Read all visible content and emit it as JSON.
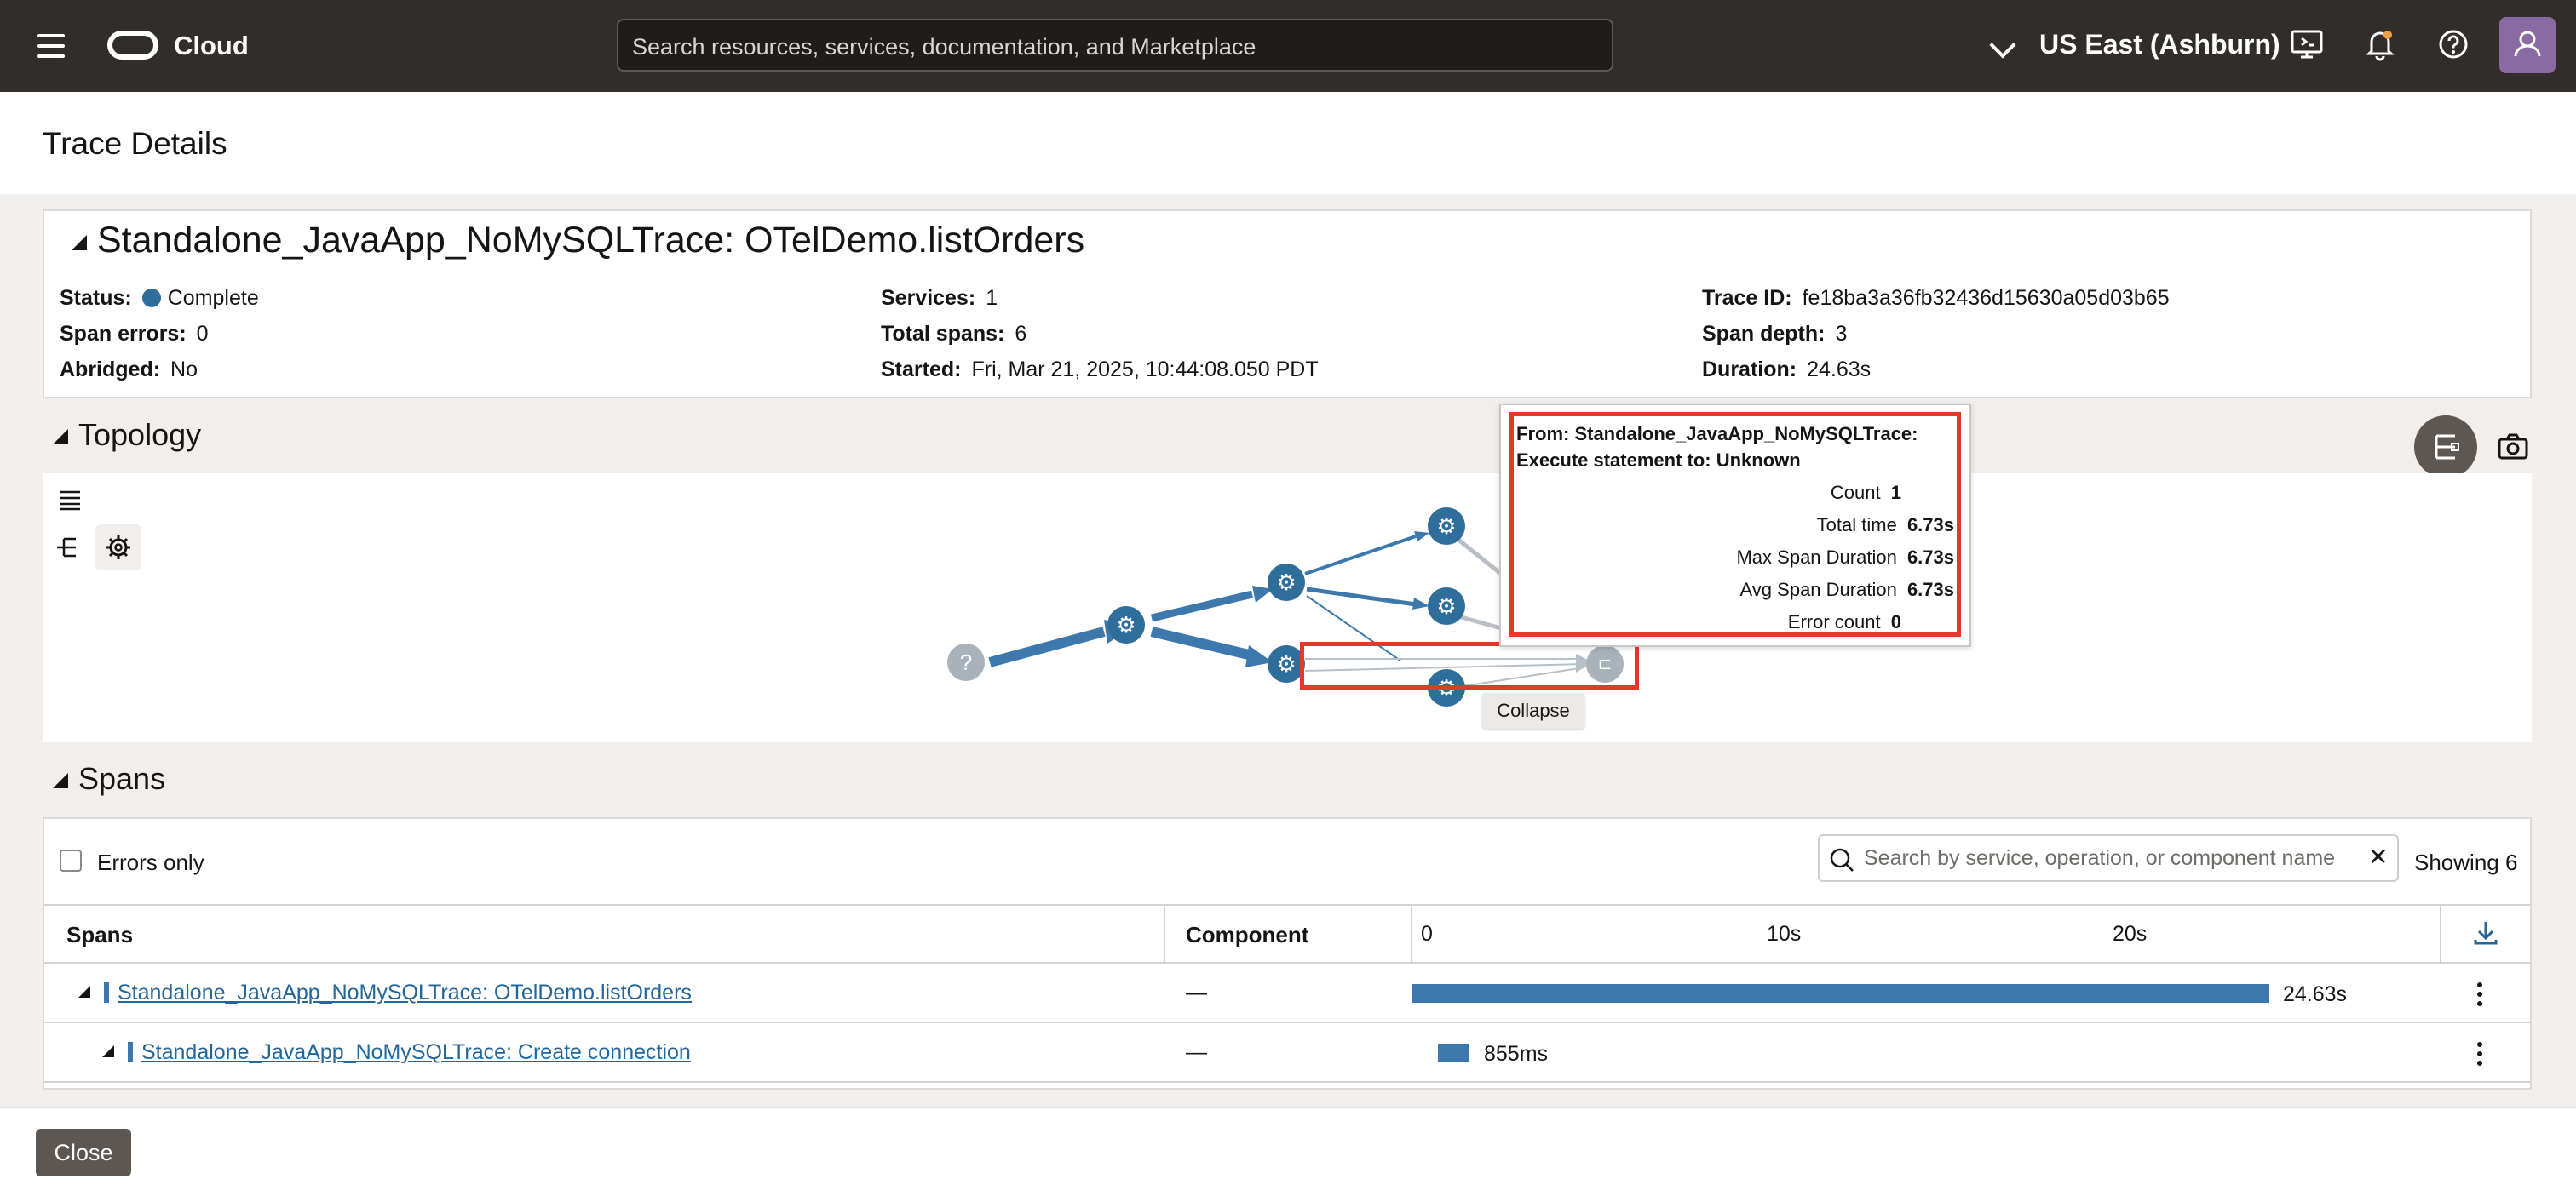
{
  "header": {
    "cloud_label": "Cloud",
    "search_placeholder": "Search resources, services, documentation, and Marketplace",
    "region": "US East (Ashburn)"
  },
  "page": {
    "title": "Trace Details"
  },
  "trace": {
    "title": "Standalone_JavaApp_NoMySQLTrace: OTelDemo.listOrders",
    "fields": {
      "status_label": "Status:",
      "status_value": "Complete",
      "span_errors_label": "Span errors:",
      "span_errors_value": "0",
      "abridged_label": "Abridged:",
      "abridged_value": "No",
      "services_label": "Services:",
      "services_value": "1",
      "total_spans_label": "Total spans:",
      "total_spans_value": "6",
      "started_label": "Started:",
      "started_value": "Fri, Mar 21, 2025, 10:44:08.050 PDT",
      "trace_id_label": "Trace ID:",
      "trace_id_value": "fe18ba3a36fb32436d15630a05d03b65",
      "span_depth_label": "Span depth:",
      "span_depth_value": "3",
      "duration_label": "Duration:",
      "duration_value": "24.63s"
    }
  },
  "topology": {
    "title": "Topology",
    "unknown_node_glyph": "?",
    "tooltip": {
      "heading": "From: Standalone_JavaApp_NoMySQLTrace: Execute statement to: Unknown",
      "count_label": "Count",
      "count_value": "1",
      "total_time_label": "Total time",
      "total_time_value": "6.73s",
      "max_label": "Max Span Duration",
      "max_value": "6.73s",
      "avg_label": "Avg Span Duration",
      "avg_value": "6.73s",
      "error_label": "Error count",
      "error_value": "0"
    },
    "collapse_tip": "Collapse"
  },
  "spans": {
    "title": "Spans",
    "errors_only": "Errors only",
    "search_placeholder": "Search by service, operation, or component name",
    "showing": "Showing 6",
    "columns": {
      "spans": "Spans",
      "component": "Component",
      "tick_0": "0",
      "tick_10": "10s",
      "tick_20": "20s"
    },
    "rows": [
      {
        "name": "Standalone_JavaApp_NoMySQLTrace: OTelDemo.listOrders",
        "component": "—",
        "duration": "24.63s",
        "fraction": 1.0
      },
      {
        "name": "Standalone_JavaApp_NoMySQLTrace: Create connection",
        "component": "—",
        "duration": "855ms",
        "fraction": 0.035
      }
    ]
  },
  "footer": {
    "close": "Close"
  },
  "colors": {
    "topbar": "#312d2a",
    "accent": "#2f6d9b",
    "highlight": "#e23a2a"
  }
}
